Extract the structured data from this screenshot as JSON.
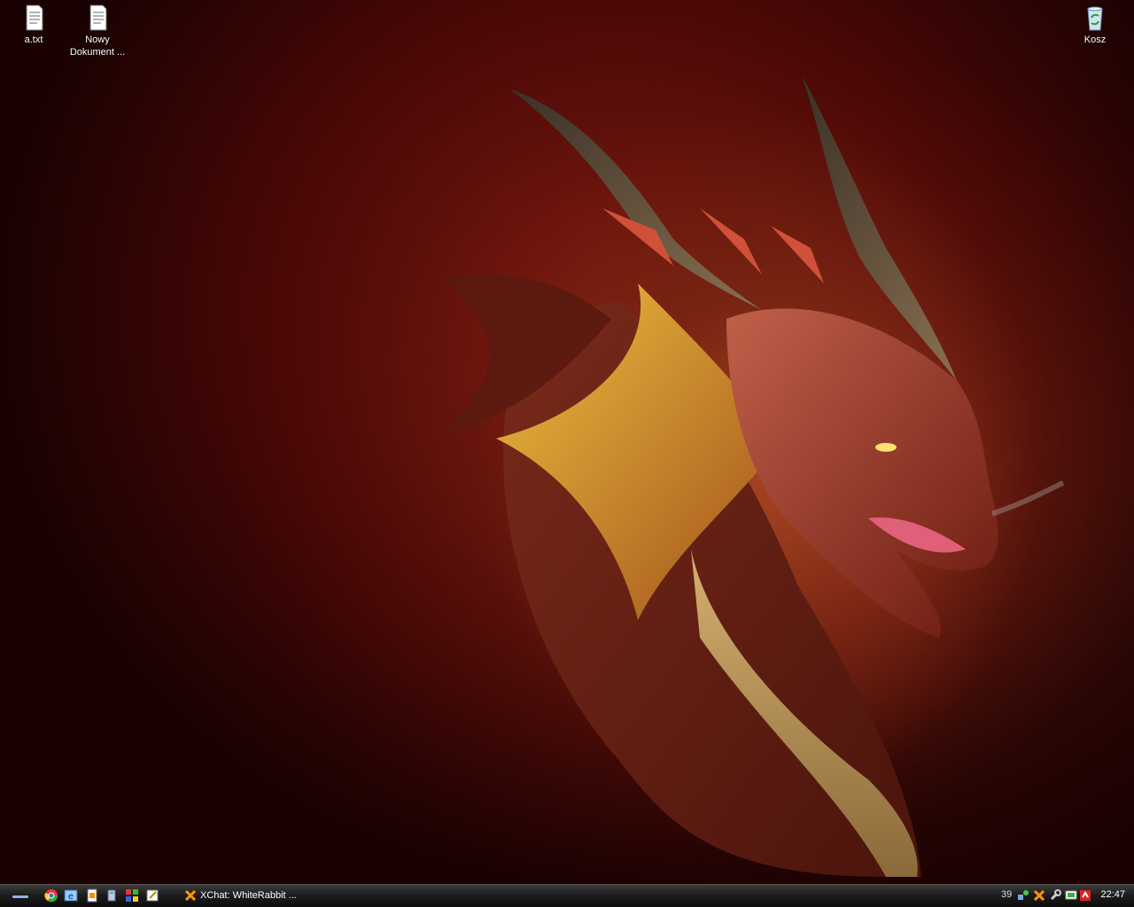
{
  "desktop": {
    "icons": [
      {
        "label": "a.txt",
        "icon": "text-file-icon"
      },
      {
        "label": "Nowy\nDokument ...",
        "icon": "text-file-icon"
      },
      {
        "label": "Kosz",
        "icon": "recycle-bin-icon"
      }
    ]
  },
  "taskbar": {
    "quick_launch": [
      "chrome-icon",
      "ie-icon",
      "notepad-icon",
      "folder-icon",
      "windows-icon",
      "edit-icon"
    ],
    "tasks": [
      {
        "label": "XChat: WhiteRabbit ...",
        "icon": "xchat-icon"
      }
    ],
    "tray": {
      "count": "39",
      "icons": [
        "network-icon",
        "xchat-tray-icon",
        "wrench-icon",
        "monitor-icon",
        "antivirus-icon"
      ],
      "clock": "22:47"
    }
  },
  "colors": {
    "wallpaper_dark": "#1a0202",
    "wallpaper_mid": "#6a1e0e",
    "taskbar": "#1b1b1b"
  }
}
